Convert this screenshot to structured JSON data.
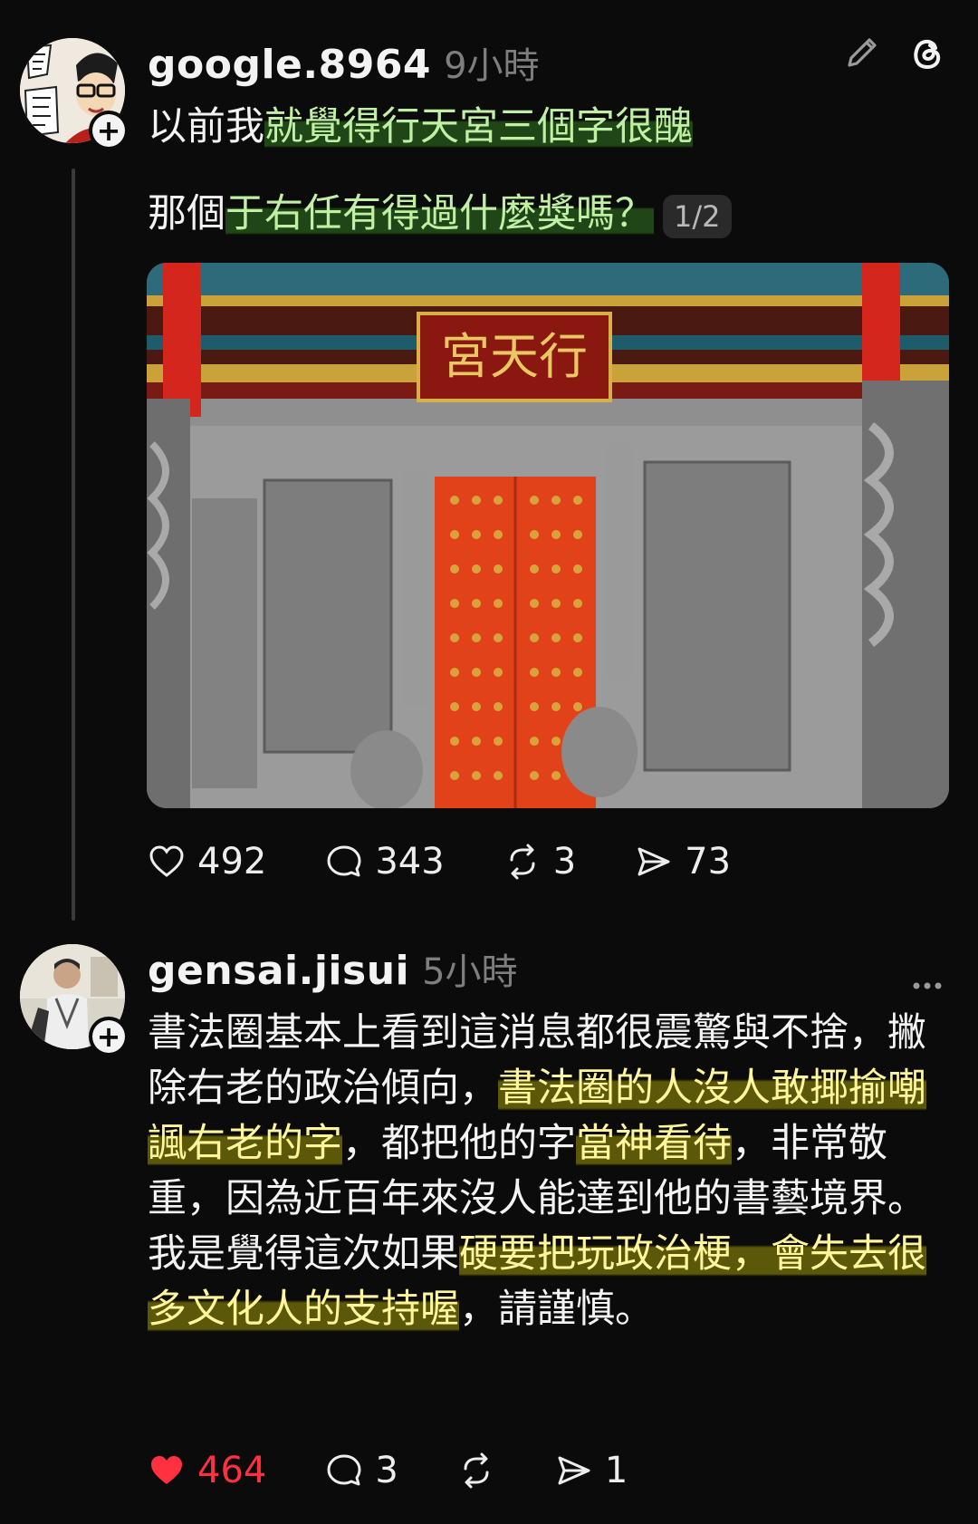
{
  "post1": {
    "username": "google.8964",
    "time": "9小時",
    "line1_plain": "以前我",
    "line1_highlight": "就覺得行天宮三個字很醜",
    "line2_plain": "那個",
    "line2_highlight": "于右任有得過什麼獎嗎？",
    "pager": "1/2",
    "likes": "492",
    "comments": "343",
    "reposts": "3",
    "shares": "73",
    "icons": [
      "edit-icon",
      "threads-logo-icon",
      "heart-icon",
      "comment-icon",
      "repost-icon",
      "share-icon"
    ]
  },
  "post2": {
    "username": "gensai.jisui",
    "time": "5小時",
    "segments": [
      {
        "t": "書法圈基本上看到這消息都很震驚與不捨，撇除右老的政治傾向，",
        "h": false
      },
      {
        "t": "書法圈的人沒人敢揶揄嘲諷右老的字",
        "h": true
      },
      {
        "t": "，都把他的字",
        "h": false
      },
      {
        "t": "當神看待",
        "h": true
      },
      {
        "t": "，非常敬重，因為近百年來沒人能達到他的書藝境界。我是覺得這次如果",
        "h": false
      },
      {
        "t": "硬要把玩政治梗，會失去很多文化人的支持喔",
        "h": true
      },
      {
        "t": "，請謹慎。",
        "h": false
      }
    ],
    "likes": "464",
    "comments": "3",
    "shares": "1",
    "liked_color": "#ff3040",
    "icons": [
      "more-icon",
      "heart-filled-icon",
      "comment-icon",
      "repost-icon",
      "share-icon"
    ]
  },
  "highlight_colors": {
    "green": "#3c9628",
    "yellow": "#aaa50a"
  }
}
